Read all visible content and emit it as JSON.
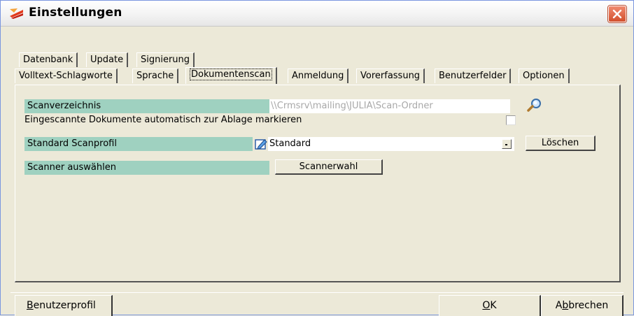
{
  "window": {
    "title": "Einstellungen"
  },
  "tabs_row1": [
    {
      "label": "Datenbank"
    },
    {
      "label": "Update"
    },
    {
      "label": "Signierung"
    }
  ],
  "tabs_row2": [
    {
      "label": "Volltext-Schlagworte"
    },
    {
      "label": "Sprache"
    },
    {
      "label": "Dokumentenscan",
      "active": true
    },
    {
      "label": "Anmeldung"
    },
    {
      "label": "Vorerfassung"
    },
    {
      "label": "Benutzerfelder"
    },
    {
      "label": "Optionen"
    }
  ],
  "scan": {
    "dir_label": "Scanverzeichnis",
    "dir_value": "\\\\Crmsrv\\mailing\\JULIA\\Scan-Ordner",
    "auto_mark_label": "Eingescannte Dokumente automatisch zur Ablage markieren",
    "auto_mark_checked": false,
    "profile_label": "Standard Scanprofil",
    "profile_value": "Standard",
    "delete_button": "Löschen",
    "scanner_label": "Scanner auswählen",
    "scanner_button": "Scannerwahl"
  },
  "footer": {
    "profile_button_first": "B",
    "profile_button_rest": "enutzerprofil",
    "ok_button_first": "O",
    "ok_button_rest": "K",
    "cancel_button_pre": "A",
    "cancel_button_u": "b",
    "cancel_button_rest": "brechen"
  },
  "colors": {
    "label_bg": "#9fd1c0",
    "window_bg": "#ece9d8",
    "placeholder_text": "#a8a8a8"
  },
  "icons": [
    "app-icon",
    "close-icon",
    "search-icon",
    "edit-profile-icon",
    "dropdown-arrow-icon"
  ]
}
